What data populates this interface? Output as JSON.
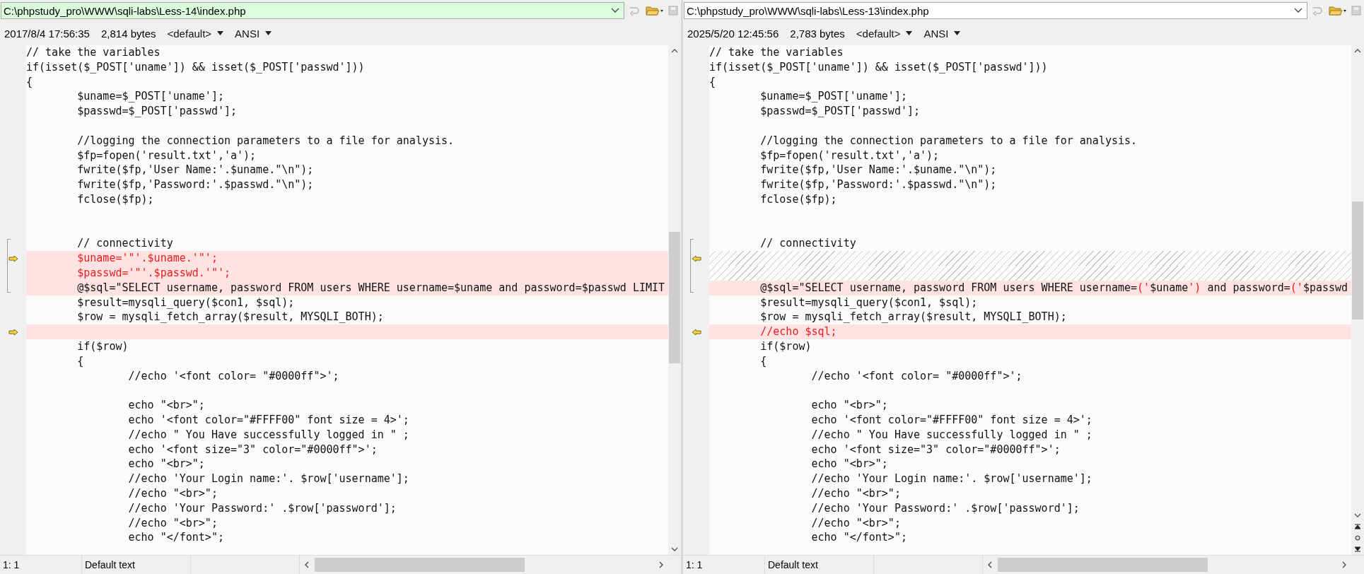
{
  "panes": [
    {
      "path": "C:\\phpstudy_pro\\WWW\\sqli-labs\\Less-14\\index.php",
      "path_highlighted": true,
      "timestamp": "2017/8/4 17:56:35",
      "size": "2,814 bytes",
      "format": "<default>",
      "encoding": "ANSI",
      "lines": [
        {
          "kind": "same",
          "text": "// take the variables"
        },
        {
          "kind": "same",
          "text": "if(isset($_POST['uname']) && isset($_POST['passwd']))"
        },
        {
          "kind": "same",
          "text": "{"
        },
        {
          "kind": "same",
          "text": "        $uname=$_POST['uname'];"
        },
        {
          "kind": "same",
          "text": "        $passwd=$_POST['passwd'];"
        },
        {
          "kind": "same"
        },
        {
          "kind": "same",
          "text": "        //logging the connection parameters to a file for analysis."
        },
        {
          "kind": "same",
          "text": "        $fp=fopen('result.txt','a');"
        },
        {
          "kind": "same",
          "text": "        fwrite($fp,'User Name:'.$uname.\"\\n\");"
        },
        {
          "kind": "same",
          "text": "        fwrite($fp,'Password:'.$passwd.\"\\n\");"
        },
        {
          "kind": "same",
          "text": "        fclose($fp);"
        },
        {
          "kind": "same"
        },
        {
          "kind": "same"
        },
        {
          "kind": "same",
          "text": "        // connectivity",
          "bracket": true
        },
        {
          "kind": "changed",
          "arrow": true,
          "bracket": true,
          "parts": [
            {
              "text": "        $uname='\"'.$uname.'\"';",
              "changed": true
            }
          ]
        },
        {
          "kind": "changed",
          "bracket": true,
          "parts": [
            {
              "text": "        $passwd='\"'.$passwd.'\"';",
              "changed": true
            }
          ]
        },
        {
          "kind": "changed",
          "bracket": true,
          "parts": [
            {
              "text": "        @$sql=\"SELECT username, password FROM users WHERE username=$uname and password=$passwd LIMIT",
              "changed": false
            }
          ]
        },
        {
          "kind": "same",
          "text": "        $result=mysqli_query($con1, $sql);"
        },
        {
          "kind": "same",
          "text": "        $row = mysqli_fetch_array($result, MYSQLI_BOTH);"
        },
        {
          "kind": "changed",
          "arrow": true
        },
        {
          "kind": "same",
          "text": "        if($row)"
        },
        {
          "kind": "same",
          "text": "        {"
        },
        {
          "kind": "same",
          "text": "                //echo '<font color= \"#0000ff\">';"
        },
        {
          "kind": "same"
        },
        {
          "kind": "same",
          "text": "                echo \"<br>\";"
        },
        {
          "kind": "same",
          "text": "                echo '<font color=\"#FFFF00\" font size = 4>';"
        },
        {
          "kind": "same",
          "text": "                //echo \" You Have successfully logged in \" ;"
        },
        {
          "kind": "same",
          "text": "                echo '<font size=\"3\" color=\"#0000ff\">';"
        },
        {
          "kind": "same",
          "text": "                echo \"<br>\";"
        },
        {
          "kind": "same",
          "text": "                //echo 'Your Login name:'. $row['username'];"
        },
        {
          "kind": "same",
          "text": "                //echo \"<br>\";"
        },
        {
          "kind": "same",
          "text": "                //echo 'Your Password:' .$row['password'];"
        },
        {
          "kind": "same",
          "text": "                //echo \"<br>\";"
        },
        {
          "kind": "same",
          "text": "                echo \"</font>\";"
        }
      ],
      "status": {
        "position": "1: 1",
        "text_style": "Default text"
      }
    },
    {
      "path": "C:\\phpstudy_pro\\WWW\\sqli-labs\\Less-13\\index.php",
      "path_highlighted": false,
      "timestamp": "2025/5/20 12:45:56",
      "size": "2,783 bytes",
      "format": "<default>",
      "encoding": "ANSI",
      "lines": [
        {
          "kind": "same",
          "text": "// take the variables"
        },
        {
          "kind": "same",
          "text": "if(isset($_POST['uname']) && isset($_POST['passwd']))"
        },
        {
          "kind": "same",
          "text": "{"
        },
        {
          "kind": "same",
          "text": "        $uname=$_POST['uname'];"
        },
        {
          "kind": "same",
          "text": "        $passwd=$_POST['passwd'];"
        },
        {
          "kind": "same"
        },
        {
          "kind": "same",
          "text": "        //logging the connection parameters to a file for analysis."
        },
        {
          "kind": "same",
          "text": "        $fp=fopen('result.txt','a');"
        },
        {
          "kind": "same",
          "text": "        fwrite($fp,'User Name:'.$uname.\"\\n\");"
        },
        {
          "kind": "same",
          "text": "        fwrite($fp,'Password:'.$passwd.\"\\n\");"
        },
        {
          "kind": "same",
          "text": "        fclose($fp);"
        },
        {
          "kind": "same"
        },
        {
          "kind": "same"
        },
        {
          "kind": "same",
          "text": "        // connectivity",
          "bracket": true
        },
        {
          "kind": "gap",
          "arrow": true,
          "bracket": true
        },
        {
          "kind": "gap",
          "bracket": true
        },
        {
          "kind": "changed",
          "bracket": true,
          "parts": [
            {
              "text": "        @$sql=\"SELECT username, password FROM users WHERE username=",
              "changed": false
            },
            {
              "text": "('",
              "changed": true
            },
            {
              "text": "$uname",
              "changed": false
            },
            {
              "text": "')",
              "changed": true
            },
            {
              "text": " and password=",
              "changed": false
            },
            {
              "text": "('",
              "changed": true
            },
            {
              "text": "$passwd",
              "changed": false
            }
          ]
        },
        {
          "kind": "same",
          "text": "        $result=mysqli_query($con1, $sql);"
        },
        {
          "kind": "same",
          "text": "        $row = mysqli_fetch_array($result, MYSQLI_BOTH);"
        },
        {
          "kind": "changed",
          "arrow": true,
          "parts": [
            {
              "text": "        //echo $sql;",
              "changed": true
            }
          ]
        },
        {
          "kind": "same",
          "text": "        if($row)"
        },
        {
          "kind": "same",
          "text": "        {"
        },
        {
          "kind": "same",
          "text": "                //echo '<font color= \"#0000ff\">';"
        },
        {
          "kind": "same"
        },
        {
          "kind": "same",
          "text": "                echo \"<br>\";"
        },
        {
          "kind": "same",
          "text": "                echo '<font color=\"#FFFF00\" font size = 4>';"
        },
        {
          "kind": "same",
          "text": "                //echo \" You Have successfully logged in \" ;"
        },
        {
          "kind": "same",
          "text": "                echo '<font size=\"3\" color=\"#0000ff\">';"
        },
        {
          "kind": "same",
          "text": "                echo \"<br>\";"
        },
        {
          "kind": "same",
          "text": "                //echo 'Your Login name:'. $row['username'];"
        },
        {
          "kind": "same",
          "text": "                //echo \"<br>\";"
        },
        {
          "kind": "same",
          "text": "                //echo 'Your Password:' .$row['password'];"
        },
        {
          "kind": "same",
          "text": "                //echo \"<br>\";"
        },
        {
          "kind": "same",
          "text": "                echo \"</font>\";"
        }
      ],
      "status": {
        "position": "1: 1",
        "text_style": "Default text"
      }
    }
  ]
}
